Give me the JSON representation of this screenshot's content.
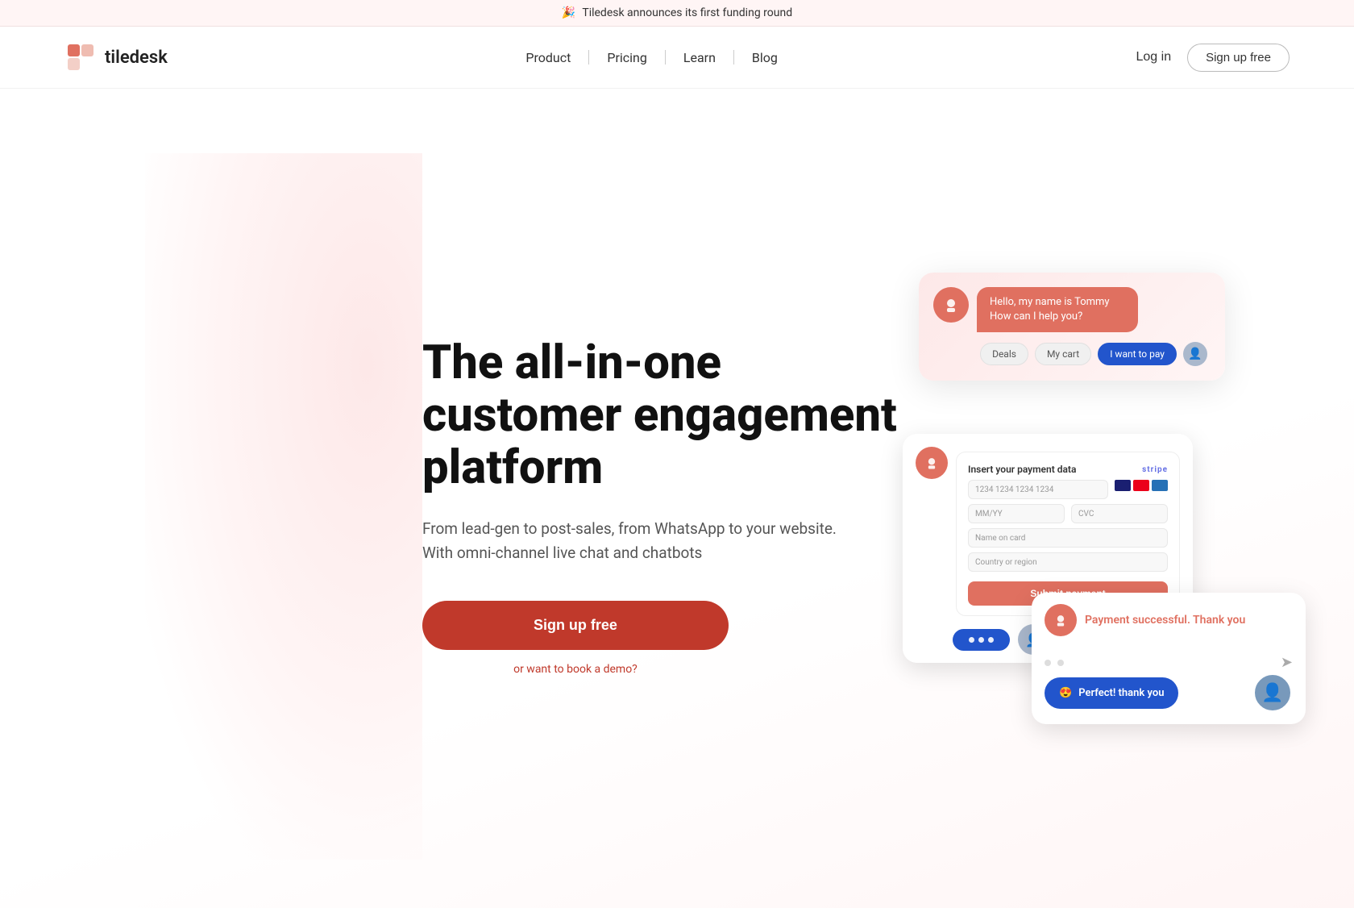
{
  "announcement": {
    "icon": "🎉",
    "text": "Tiledesk announces its first funding round"
  },
  "header": {
    "logo_text": "tiledesk",
    "nav": [
      {
        "label": "Product",
        "id": "product"
      },
      {
        "label": "Pricing",
        "id": "pricing"
      },
      {
        "label": "Learn",
        "id": "learn"
      },
      {
        "label": "Blog",
        "id": "blog"
      }
    ],
    "login_label": "Log in",
    "signup_label": "Sign up free"
  },
  "hero": {
    "title": "The all-in-one customer engagement platform",
    "subtitle": "From lead-gen to post-sales, from WhatsApp to your website. With omni-channel live chat and chatbots",
    "cta_label": "Sign up free",
    "demo_label": "or want to book a demo?"
  },
  "chat": {
    "bot_greeting": "Hello, my name is Tommy How can I help you?",
    "chip_deals": "Deals",
    "chip_cart": "My cart",
    "chip_pay": "I want to pay",
    "payment_title": "Insert your payment data",
    "stripe_label": "stripe",
    "card_number_placeholder": "1234 1234 1234 1234",
    "mm_yy_placeholder": "MM/YY",
    "cvc_placeholder": "CVC",
    "name_placeholder": "Name on card",
    "country_placeholder": "Country or region",
    "submit_label": "Submit payment",
    "success_text": "Payment successful. Thank you",
    "thank_you_text": "Perfect! thank you",
    "thank_you_emoji": "😍"
  }
}
